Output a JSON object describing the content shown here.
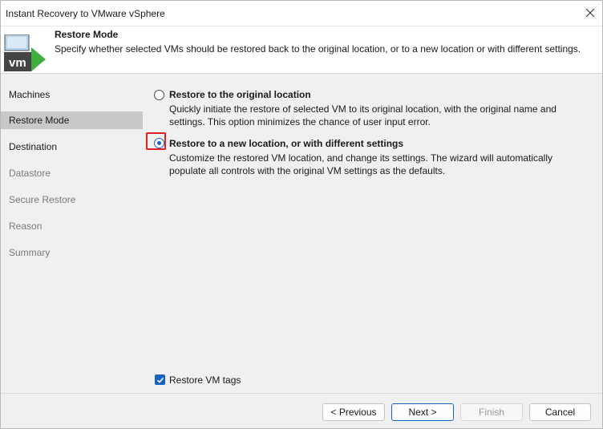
{
  "window": {
    "title": "Instant Recovery to VMware vSphere",
    "close_icon": "close-icon"
  },
  "header": {
    "title": "Restore Mode",
    "description": "Specify whether selected VMs should be restored back to the original location, or to a new location or with different settings.",
    "icon_text": "vm"
  },
  "nav": {
    "items": [
      {
        "label": "Machines",
        "state": "enabled"
      },
      {
        "label": "Restore Mode",
        "state": "active"
      },
      {
        "label": "Destination",
        "state": "enabled"
      },
      {
        "label": "Datastore",
        "state": "disabled"
      },
      {
        "label": "Secure Restore",
        "state": "disabled"
      },
      {
        "label": "Reason",
        "state": "disabled"
      },
      {
        "label": "Summary",
        "state": "disabled"
      }
    ]
  },
  "options": {
    "original": {
      "label": "Restore to the original location",
      "description": "Quickly initiate the restore of selected VM to its original location, with the original name and settings. This option minimizes the chance of user input error.",
      "selected": false
    },
    "new_location": {
      "label": "Restore to a new location, or with different settings",
      "description": "Customize the restored VM location, and change its settings. The wizard will automatically populate all controls with the original VM settings as the defaults.",
      "selected": true
    }
  },
  "restore_vm_tags": {
    "label": "Restore VM tags",
    "checked": true
  },
  "footer": {
    "previous_label": "< Previous",
    "next_label": "Next >",
    "finish_label": "Finish",
    "cancel_label": "Cancel"
  },
  "colors": {
    "accent": "#1565c0",
    "highlight": "#e02020",
    "icon_green": "#3fae3f"
  }
}
